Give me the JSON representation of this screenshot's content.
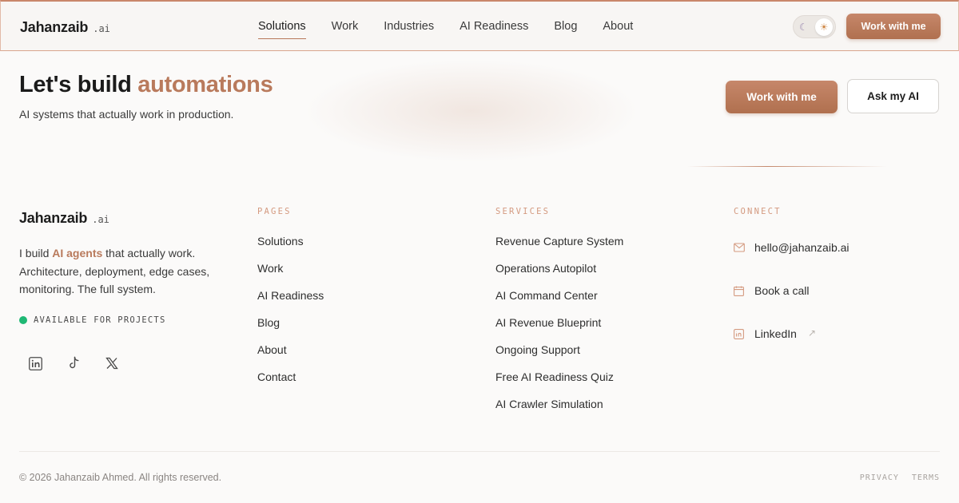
{
  "brand": {
    "name": "Jahanzaib",
    "tld": ".ai"
  },
  "nav": {
    "items": [
      "Solutions",
      "Work",
      "Industries",
      "AI Readiness",
      "Blog",
      "About"
    ],
    "active_index": 0
  },
  "theme_toggle": {
    "moon_icon": "moon-icon",
    "sun_icon": "sun-icon",
    "selected": "light"
  },
  "header": {
    "cta_label": "Work with me"
  },
  "hero": {
    "title_prefix": "Let's build ",
    "title_accent": "automations",
    "subtitle": "AI systems that actually work in production.",
    "primary_cta": "Work with me",
    "secondary_cta": "Ask my AI"
  },
  "footer": {
    "desc_prefix": "I build ",
    "desc_highlight": "AI agents",
    "desc_suffix": " that actually work. Architecture, deployment, edge cases, monitoring. The full system.",
    "availability": "AVAILABLE FOR PROJECTS",
    "socials": [
      "linkedin-icon",
      "tiktok-icon",
      "x-icon"
    ],
    "pages": {
      "heading": "PAGES",
      "items": [
        "Solutions",
        "Work",
        "AI Readiness",
        "Blog",
        "About",
        "Contact"
      ]
    },
    "services": {
      "heading": "SERVICES",
      "items": [
        "Revenue Capture System",
        "Operations Autopilot",
        "AI Command Center",
        "AI Revenue Blueprint",
        "Ongoing Support",
        "Free AI Readiness Quiz",
        "AI Crawler Simulation"
      ]
    },
    "connect": {
      "heading": "CONNECT",
      "email": "hello@jahanzaib.ai",
      "book": "Book a call",
      "linkedin": "LinkedIn"
    },
    "copyright": "© 2026 Jahanzaib Ahmed. All rights reserved.",
    "privacy": "PRIVACY",
    "terms": "TERMS"
  },
  "colors": {
    "accent": "#b97a5c",
    "available": "#1fb874",
    "label": "#d49a80"
  }
}
